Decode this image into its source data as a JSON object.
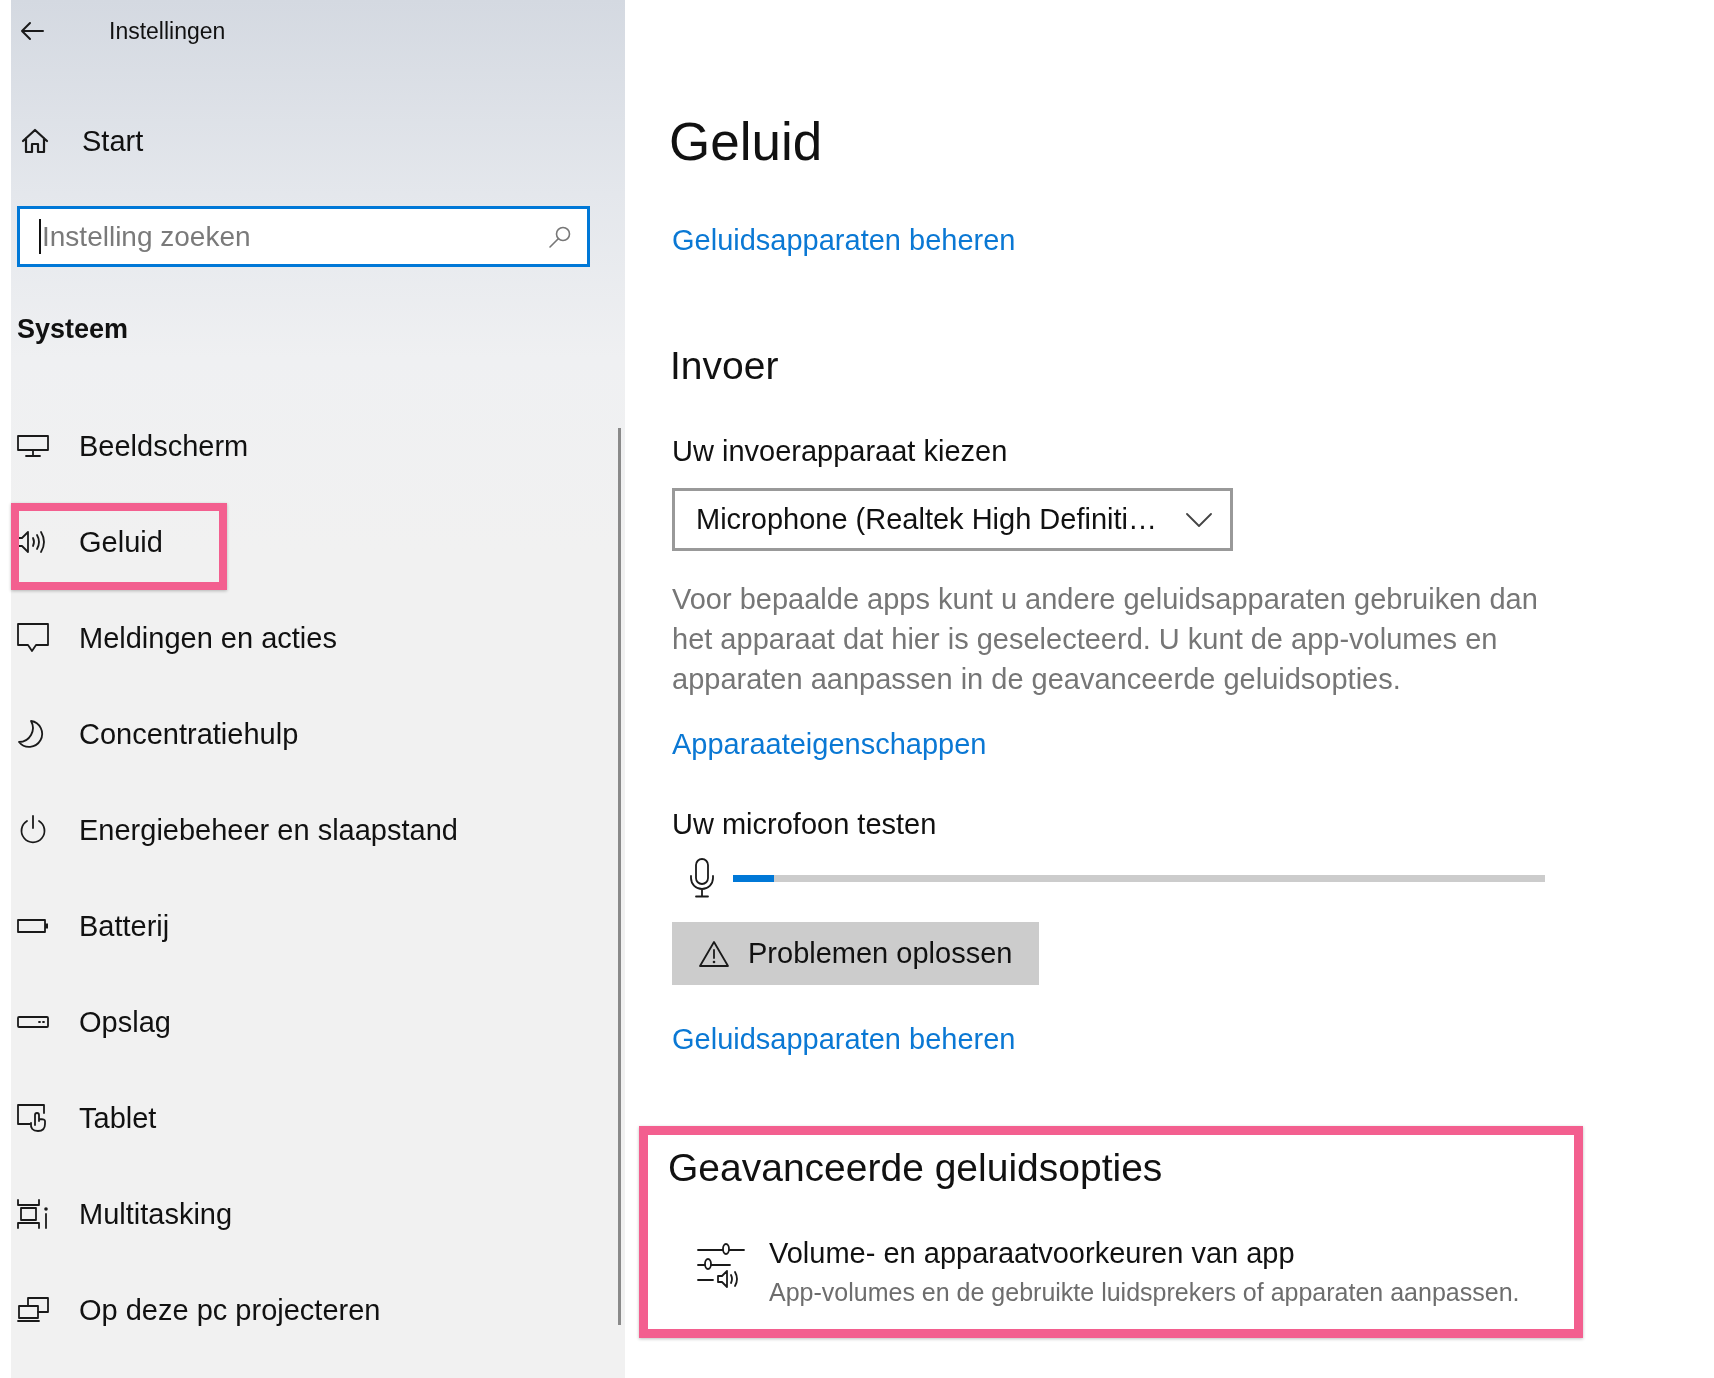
{
  "window": {
    "title": "Instellingen"
  },
  "sidebar": {
    "home": {
      "label": "Start"
    },
    "search": {
      "placeholder": "Instelling zoeken",
      "focused": true
    },
    "section_title": "Systeem",
    "items": [
      {
        "label": "Beeldscherm",
        "highlighted": false
      },
      {
        "label": "Geluid",
        "highlighted": true
      },
      {
        "label": "Meldingen en acties",
        "highlighted": false
      },
      {
        "label": "Concentratiehulp",
        "highlighted": false
      },
      {
        "label": "Energiebeheer en slaapstand",
        "highlighted": false
      },
      {
        "label": "Batterij",
        "highlighted": false
      },
      {
        "label": "Opslag",
        "highlighted": false
      },
      {
        "label": "Tablet",
        "highlighted": false
      },
      {
        "label": "Multitasking",
        "highlighted": false
      },
      {
        "label": "Op deze pc projecteren",
        "highlighted": false
      }
    ]
  },
  "page": {
    "title": "Geluid",
    "top_link": "Geluidsapparaten beheren",
    "input": {
      "heading": "Invoer",
      "device_label": "Uw invoerapparaat kiezen",
      "device_select": {
        "value": "Microphone (Realtek High Definiti…"
      },
      "description": "Voor bepaalde apps kunt u andere geluidsapparaten gebruiken dan het apparaat dat hier is geselecteerd. U kunt de app-volumes en apparaten aanpassen in de geavanceerde geluidsopties.",
      "properties_link": "Apparaateigenschappen",
      "test_label": "Uw microfoon testen",
      "mic_meter": {
        "level": 0.05
      },
      "troubleshoot_button": "Problemen oplossen",
      "manage_link": "Geluidsapparaten beheren"
    },
    "advanced": {
      "heading": "Geavanceerde geluidsopties",
      "highlighted": true,
      "options": [
        {
          "title": "Volume- en apparaatvoorkeuren van app",
          "description": "App-volumes en de gebruikte luidsprekers of apparaten aanpassen."
        }
      ]
    }
  }
}
